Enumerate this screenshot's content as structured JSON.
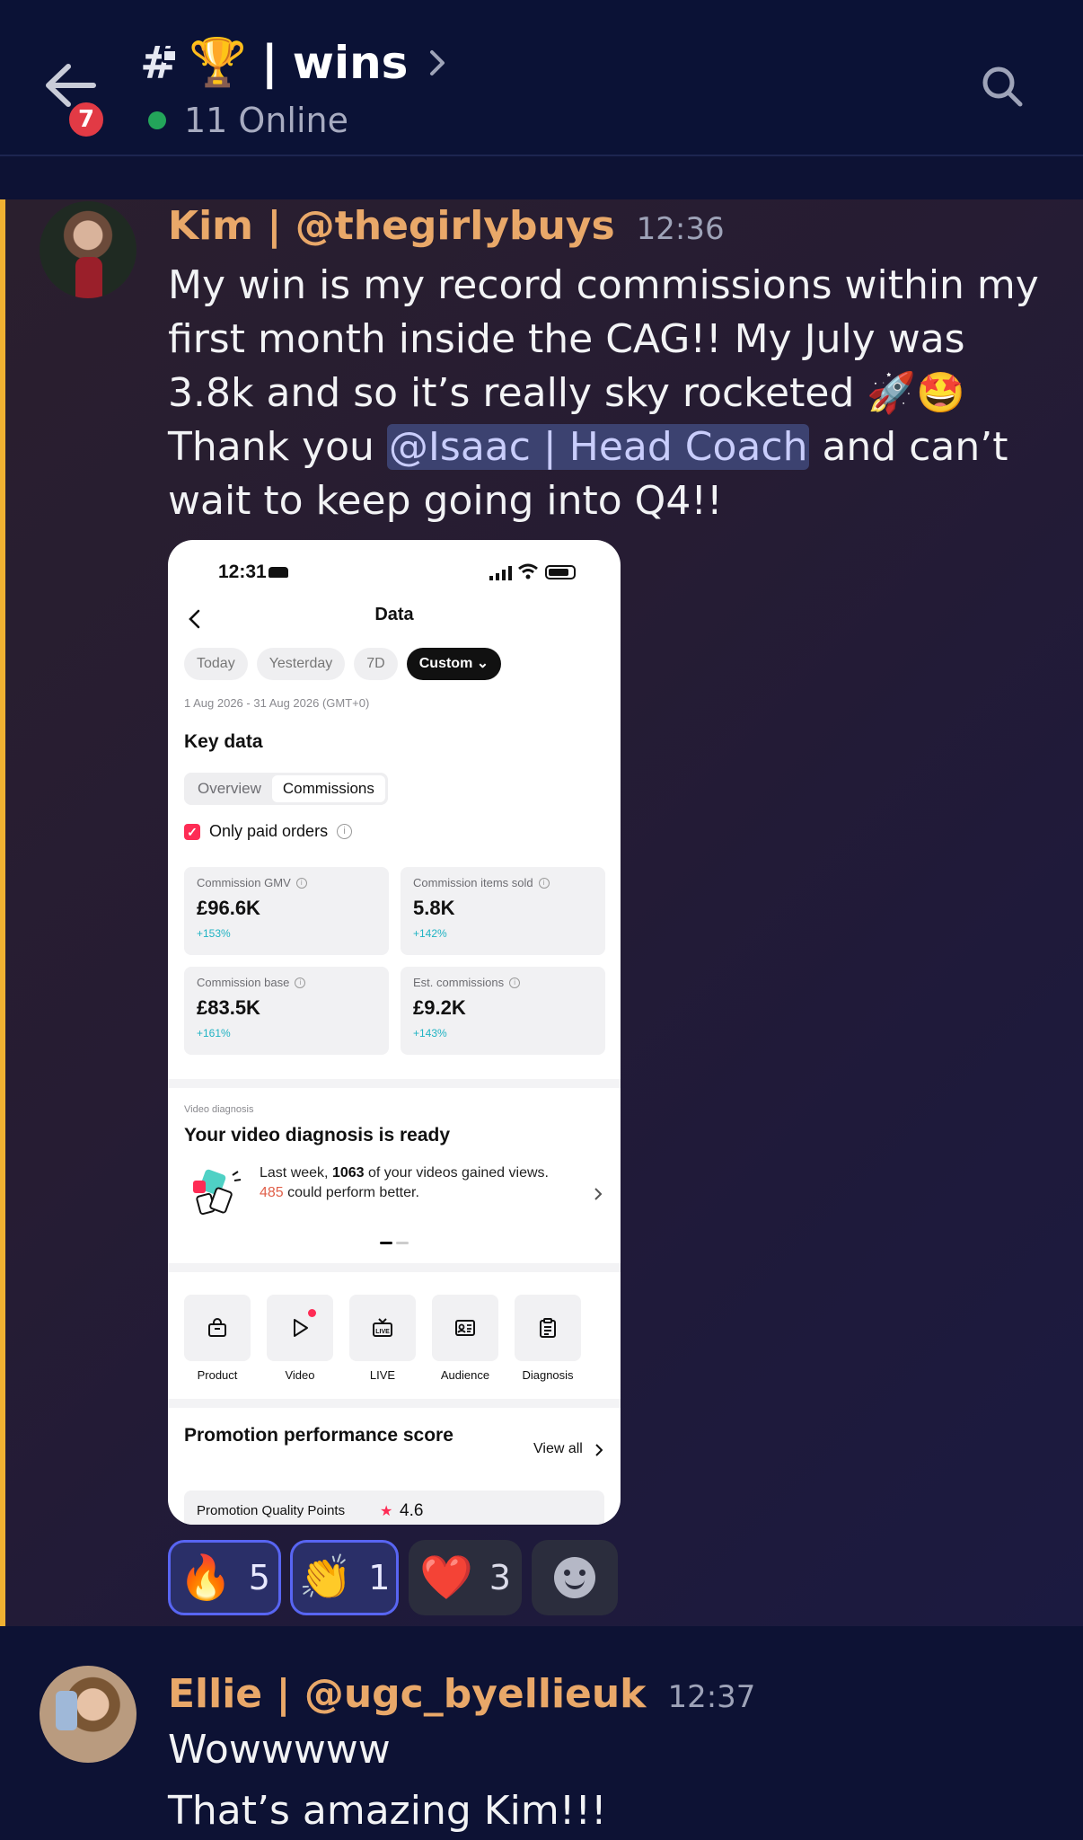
{
  "header": {
    "back_badge": "7",
    "channel_emoji": "🏆",
    "separator": "|",
    "channel_name": "wins",
    "online_text": "11 Online"
  },
  "message1": {
    "author": "Kim | @thegirlybuys",
    "time": "12:36",
    "text_before": "My win is my record commissions within my first month inside the CAG!! My July was 3.8k and so it’s really sky rocketed 🚀🤩Thank you ",
    "mention": "@Isaac | Head Coach",
    "text_after": " and can’t wait to keep going into Q4!!"
  },
  "screenshot": {
    "status_time": "12:31",
    "title": "Data",
    "chips": [
      "Today",
      "Yesterday",
      "7D",
      "Custom"
    ],
    "date_range": "1 Aug 2026 - 31 Aug 2026 (GMT+0)",
    "key_data_title": "Key data",
    "tabs": [
      "Overview",
      "Commissions"
    ],
    "paid_only_label": "Only paid orders",
    "cards": [
      {
        "label": "Commission GMV",
        "value": "£96.6K",
        "delta": "+153%"
      },
      {
        "label": "Commission items sold",
        "value": "5.8K",
        "delta": "+142%"
      },
      {
        "label": "Commission base",
        "value": "£83.5K",
        "delta": "+161%"
      },
      {
        "label": "Est. commissions",
        "value": "£9.2K",
        "delta": "+143%"
      }
    ],
    "video_diag_kicker": "Video diagnosis",
    "video_diag_title": "Your video diagnosis is ready",
    "video_diag_pre": "Last week, ",
    "video_diag_count": "1063",
    "video_diag_mid": " of your videos gained views. ",
    "video_diag_better": "485",
    "video_diag_post": " could perform better.",
    "tools": [
      "Product",
      "Video",
      "LIVE",
      "Audience",
      "Diagnosis"
    ],
    "promo_title": "Promotion performance score",
    "view_all": "View all",
    "pqp_label": "Promotion Quality Points",
    "pqp_value": "4.6"
  },
  "reactions": [
    {
      "emoji": "🔥",
      "count": "5",
      "mine": true
    },
    {
      "emoji": "👏",
      "count": "1",
      "mine": true
    },
    {
      "emoji": "❤️",
      "count": "3",
      "mine": false
    }
  ],
  "message2": {
    "author": "Ellie | @ugc_byellieuk",
    "time": "12:37",
    "lines": [
      "Wowwwww",
      "That’s amazing Kim!!!"
    ]
  },
  "colors": {
    "accent": "#5865f2",
    "highlight_bar": "#f0b132",
    "username": "#e9a869",
    "online": "#23a55a",
    "tiktok_red": "#fe2c55"
  }
}
